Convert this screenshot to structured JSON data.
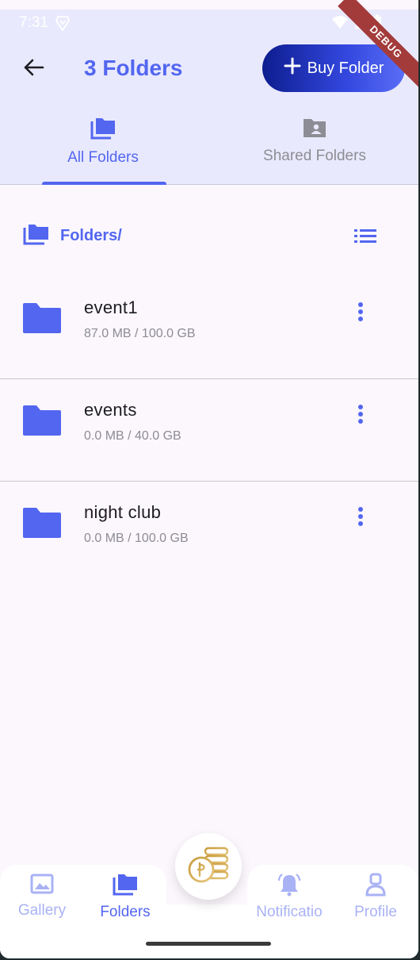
{
  "status_bar": {
    "time": "7:31",
    "debug_label": "DEBUG"
  },
  "header": {
    "title": "3 Folders",
    "buy_button_label": "Buy Folder"
  },
  "tabs": [
    {
      "label": "All Folders",
      "active": true
    },
    {
      "label": "Shared Folders",
      "active": false
    }
  ],
  "breadcrumb": {
    "path": "Folders/"
  },
  "folders": [
    {
      "name": "event1",
      "size": "87.0 MB / 100.0 GB"
    },
    {
      "name": "events",
      "size": "0.0 MB / 40.0 GB"
    },
    {
      "name": "night club",
      "size": "0.0 MB / 100.0 GB"
    }
  ],
  "bottom_nav": {
    "items": [
      {
        "label": "Gallery",
        "icon": "gallery-icon",
        "active": false
      },
      {
        "label": "Folders",
        "icon": "folders-icon",
        "active": true
      },
      {
        "label": "Notificatio",
        "icon": "bell-icon",
        "active": false
      },
      {
        "label": "Profile",
        "icon": "profile-icon",
        "active": false
      }
    ],
    "center_icon": "coins-icon"
  },
  "colors": {
    "primary": "#5366f0",
    "appbar_bg": "#e9e9fd",
    "page_bg": "#fbf7fd",
    "nav_inactive": "#a9b2f5",
    "button_gradient_start": "#0d1d8f",
    "button_gradient_end": "#5a6df6"
  }
}
